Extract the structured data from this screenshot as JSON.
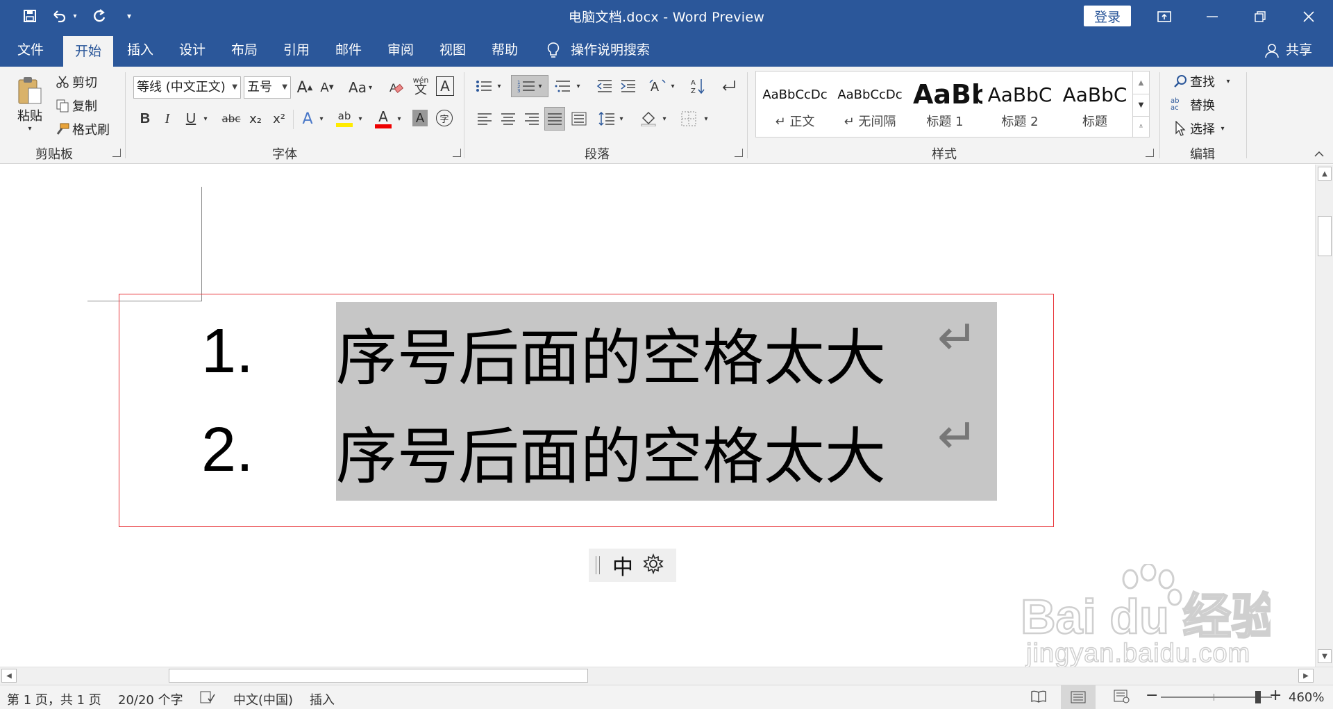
{
  "titlebar": {
    "title": "电脑文档.docx  -  Word Preview",
    "login": "登录",
    "quick_access": [
      "save-icon",
      "undo-icon",
      "redo-icon",
      "customize-icon"
    ]
  },
  "tabs": [
    "文件",
    "开始",
    "插入",
    "设计",
    "布局",
    "引用",
    "邮件",
    "审阅",
    "视图",
    "帮助"
  ],
  "tell_me": "操作说明搜索",
  "share": "共享",
  "clipboard": {
    "group": "剪贴板",
    "paste": "粘贴",
    "cut": "剪切",
    "copy": "复制",
    "format_painter": "格式刷"
  },
  "font": {
    "group": "字体",
    "font_name": "等线 (中文正文)",
    "font_size": "五号",
    "change_case": "Aa",
    "phonetic": "wén",
    "phonetic_char": "文",
    "char_border": "A",
    "bold": "B",
    "italic": "I",
    "underline": "U",
    "strike": "abc",
    "subscript": "x₂",
    "superscript": "x²",
    "grow": "A",
    "shrink": "A",
    "effects": "A",
    "highlight": "ab",
    "font_color": "A",
    "char_shading": "A",
    "enclose": "字"
  },
  "paragraph": {
    "group": "段落"
  },
  "styles": {
    "group": "样式",
    "items": [
      {
        "preview": "AaBbCcDc",
        "name": "↵ 正文"
      },
      {
        "preview": "AaBbCcDc",
        "name": "↵ 无间隔"
      },
      {
        "preview": "AaBb",
        "name": "标题 1"
      },
      {
        "preview": "AaBbC",
        "name": "标题 2"
      },
      {
        "preview": "AaBbC",
        "name": "标题"
      }
    ]
  },
  "editing": {
    "group": "编辑",
    "find": "查找",
    "replace": "替换",
    "select": "选择",
    "replace_glyph": "ab ac"
  },
  "document": {
    "list": [
      {
        "number": "1.",
        "text": "序号后面的空格太大",
        "mark": "↵"
      },
      {
        "number": "2.",
        "text": "序号后面的空格太大",
        "mark": "↵"
      }
    ],
    "ime": "中"
  },
  "watermark": {
    "brand": "Bai du 经验",
    "url": "jingyan.baidu.com"
  },
  "status": {
    "page": "第 1 页，共 1 页",
    "words": "20/20 个字",
    "language": "中文(中国)",
    "mode": "插入",
    "zoom": "460%"
  },
  "colors": {
    "brand": "#2b579a",
    "selection": "#c6c6c6",
    "annotation": "#e8353a"
  }
}
